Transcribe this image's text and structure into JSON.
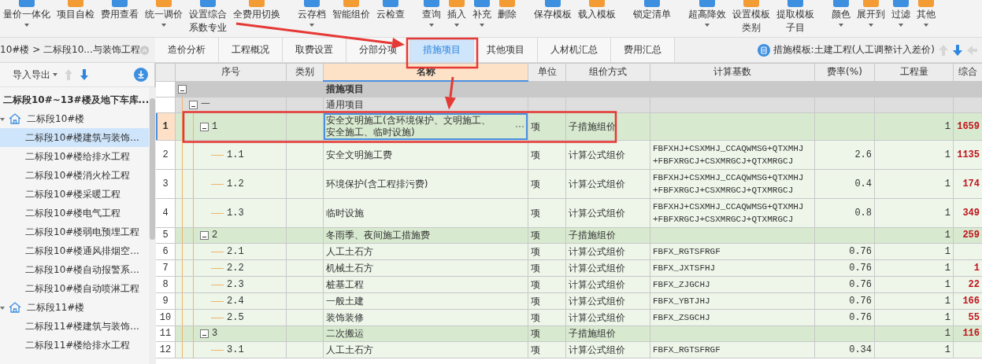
{
  "toolbar": {
    "groups": [
      [
        {
          "lines": [
            "量价一体化"
          ],
          "dropdown": true
        },
        {
          "lines": [
            "项目自检"
          ],
          "dropdown": false
        },
        {
          "lines": [
            "费用查看"
          ],
          "dropdown": false
        },
        {
          "lines": [
            "统一调价"
          ],
          "dropdown": true
        },
        {
          "lines": [
            "设置综合",
            "系数专业"
          ],
          "dropdown": false
        },
        {
          "lines": [
            "全费用切换"
          ],
          "dropdown": false
        }
      ],
      [
        {
          "lines": [
            "云存档"
          ],
          "dropdown": true
        },
        {
          "lines": [
            "智能组价"
          ],
          "dropdown": false
        },
        {
          "lines": [
            "云检查"
          ],
          "dropdown": false
        }
      ],
      [
        {
          "lines": [
            "查询"
          ],
          "dropdown": true
        },
        {
          "lines": [
            "插入"
          ],
          "dropdown": true
        },
        {
          "lines": [
            "补充"
          ],
          "dropdown": true
        },
        {
          "lines": [
            "删除"
          ],
          "dropdown": false
        }
      ],
      [
        {
          "lines": [
            "保存模板"
          ],
          "dropdown": false
        },
        {
          "lines": [
            "载入模板"
          ],
          "dropdown": false
        }
      ],
      [
        {
          "lines": [
            "锁定清单"
          ],
          "dropdown": false
        }
      ],
      [
        {
          "lines": [
            "超高降效"
          ],
          "dropdown": true
        },
        {
          "lines": [
            "设置模板",
            "类别"
          ],
          "dropdown": false
        },
        {
          "lines": [
            "提取模板",
            "子目"
          ],
          "dropdown": false
        }
      ],
      [
        {
          "lines": [
            "颜色"
          ],
          "dropdown": true
        },
        {
          "lines": [
            "展开到"
          ],
          "dropdown": true
        },
        {
          "lines": [
            "过滤"
          ],
          "dropdown": true
        },
        {
          "lines": [
            "其他"
          ],
          "dropdown": true
        }
      ]
    ]
  },
  "breadcrumb": "10#楼 > 二标段10...与装饰工程",
  "tabs": [
    {
      "label": "造价分析",
      "selected": false
    },
    {
      "label": "工程概况",
      "selected": false
    },
    {
      "label": "取费设置",
      "selected": false
    },
    {
      "label": "分部分项",
      "selected": false
    },
    {
      "label": "措施项目",
      "selected": true
    },
    {
      "label": "其他项目",
      "selected": false
    },
    {
      "label": "人材机汇总",
      "selected": false
    },
    {
      "label": "费用汇总",
      "selected": false
    }
  ],
  "template": "措施模板:土建工程(人工调整计入差价)",
  "side_panel": {
    "import_export": "导入导出",
    "tree": [
      {
        "label": "二标段10#~13#楼及地下车库...",
        "kind": "project",
        "selected": false,
        "children": [
          {
            "label": "二标段10#楼",
            "kind": "building",
            "selected": false,
            "expanded": true,
            "children": [
              {
                "label": "二标段10#楼建筑与装饰...",
                "kind": "unit",
                "selected": true
              },
              {
                "label": "二标段10#楼给排水工程",
                "kind": "unit",
                "selected": false
              },
              {
                "label": "二标段10#楼消火栓工程",
                "kind": "unit",
                "selected": false
              },
              {
                "label": "二标段10#楼采暖工程",
                "kind": "unit",
                "selected": false
              },
              {
                "label": "二标段10#楼电气工程",
                "kind": "unit",
                "selected": false
              },
              {
                "label": "二标段10#楼弱电预埋工程",
                "kind": "unit",
                "selected": false
              },
              {
                "label": "二标段10#楼通风排烟空...",
                "kind": "unit",
                "selected": false
              },
              {
                "label": "二标段10#楼自动报警系...",
                "kind": "unit",
                "selected": false
              },
              {
                "label": "二标段10#楼自动喷淋工程",
                "kind": "unit",
                "selected": false
              }
            ]
          },
          {
            "label": "二标段11#楼",
            "kind": "building",
            "selected": false,
            "expanded": true,
            "children": [
              {
                "label": "二标段11#楼建筑与装饰...",
                "kind": "unit",
                "selected": false
              },
              {
                "label": "二标段11#楼给排水工程",
                "kind": "unit",
                "selected": false
              }
            ]
          }
        ]
      }
    ]
  },
  "table": {
    "columns": [
      {
        "label": "序号",
        "selected": false
      },
      {
        "label": "类别",
        "selected": false
      },
      {
        "label": "名称",
        "selected": true
      },
      {
        "label": "单位",
        "selected": false
      },
      {
        "label": "组价方式",
        "selected": false
      },
      {
        "label": "计算基数",
        "selected": false
      },
      {
        "label": "费率(%)",
        "selected": false
      },
      {
        "label": "工程量",
        "selected": false
      },
      {
        "label": "综合",
        "selected": false
      }
    ],
    "rows": [
      {
        "kind": "section",
        "name": "措施项目",
        "selected": false,
        "expanded": true,
        "children": [
          {
            "kind": "group",
            "code": "一",
            "name": "通用项目",
            "selected": false,
            "expanded": true,
            "children": [
              {
                "kind": "parent",
                "row_no": "1",
                "code": "1",
                "name": "安全文明施工(含环境保护、文明施工、安全施工、临时设施)",
                "unit": "项",
                "method": "子措施组价",
                "qty": "1",
                "total": "1659",
                "selected": true,
                "expanded": true,
                "children": [
                  {
                    "kind": "child",
                    "row_no": "2",
                    "code": "1.1",
                    "name": "安全文明施工费",
                    "unit": "项",
                    "method": "计算公式组价",
                    "base": "FBFXHJ+CSXMHJ_CCAQWMSG+QTXMHJ+FBFXRGCJ+CSXMRGCJ+QTXMRGCJ",
                    "rate": "2.6",
                    "qty": "1",
                    "total": "1135",
                    "selected": false
                  },
                  {
                    "kind": "child",
                    "row_no": "3",
                    "code": "1.2",
                    "name": "环境保护(含工程排污费)",
                    "unit": "项",
                    "method": "计算公式组价",
                    "base": "FBFXHJ+CSXMHJ_CCAQWMSG+QTXMHJ+FBFXRGCJ+CSXMRGCJ+QTXMRGCJ",
                    "rate": "0.4",
                    "qty": "1",
                    "total": "174",
                    "selected": false
                  },
                  {
                    "kind": "child",
                    "row_no": "4",
                    "code": "1.3",
                    "name": "临时设施",
                    "unit": "项",
                    "method": "计算公式组价",
                    "base": "FBFXHJ+CSXMHJ_CCAQWMSG+QTXMHJ+FBFXRGCJ+CSXMRGCJ+QTXMRGCJ",
                    "rate": "0.8",
                    "qty": "1",
                    "total": "349",
                    "selected": false
                  }
                ]
              },
              {
                "kind": "parent",
                "row_no": "5",
                "code": "2",
                "name": "冬雨季、夜间施工措施费",
                "unit": "项",
                "method": "子措施组价",
                "qty": "1",
                "total": "259",
                "selected": false,
                "expanded": true,
                "children": [
                  {
                    "kind": "child",
                    "row_no": "6",
                    "code": "2.1",
                    "name": "人工土石方",
                    "unit": "项",
                    "method": "计算公式组价",
                    "base": "FBFX_RGTSFRGF",
                    "rate": "0.76",
                    "qty": "1",
                    "selected": false
                  },
                  {
                    "kind": "child",
                    "row_no": "7",
                    "code": "2.2",
                    "name": "机械土石方",
                    "unit": "项",
                    "method": "计算公式组价",
                    "base": "FBFX_JXTSFHJ",
                    "rate": "0.76",
                    "qty": "1",
                    "total": "1",
                    "selected": false
                  },
                  {
                    "kind": "child",
                    "row_no": "8",
                    "code": "2.3",
                    "name": "桩基工程",
                    "unit": "项",
                    "method": "计算公式组价",
                    "base": "FBFX_ZJGCHJ",
                    "rate": "0.76",
                    "qty": "1",
                    "total": "22",
                    "selected": false
                  },
                  {
                    "kind": "child",
                    "row_no": "9",
                    "code": "2.4",
                    "name": "一般土建",
                    "unit": "项",
                    "method": "计算公式组价",
                    "base": "FBFX_YBTJHJ",
                    "rate": "0.76",
                    "qty": "1",
                    "total": "166",
                    "selected": false
                  },
                  {
                    "kind": "child",
                    "row_no": "10",
                    "code": "2.5",
                    "name": "装饰装修",
                    "unit": "项",
                    "method": "计算公式组价",
                    "base": "FBFX_ZSGCHJ",
                    "rate": "0.76",
                    "qty": "1",
                    "total": "55",
                    "selected": false
                  }
                ]
              },
              {
                "kind": "parent",
                "row_no": "11",
                "code": "3",
                "name": "二次搬运",
                "unit": "项",
                "method": "子措施组价",
                "qty": "1",
                "total": "116",
                "selected": false,
                "expanded": true,
                "children": [
                  {
                    "kind": "child",
                    "row_no": "12",
                    "code": "3.1",
                    "name": "人工土石方",
                    "unit": "项",
                    "method": "计算公式组价",
                    "base": "FBFX_RGTSFRGF",
                    "rate": "0.34",
                    "qty": "1",
                    "selected": false
                  }
                ]
              }
            ]
          }
        ]
      }
    ]
  }
}
